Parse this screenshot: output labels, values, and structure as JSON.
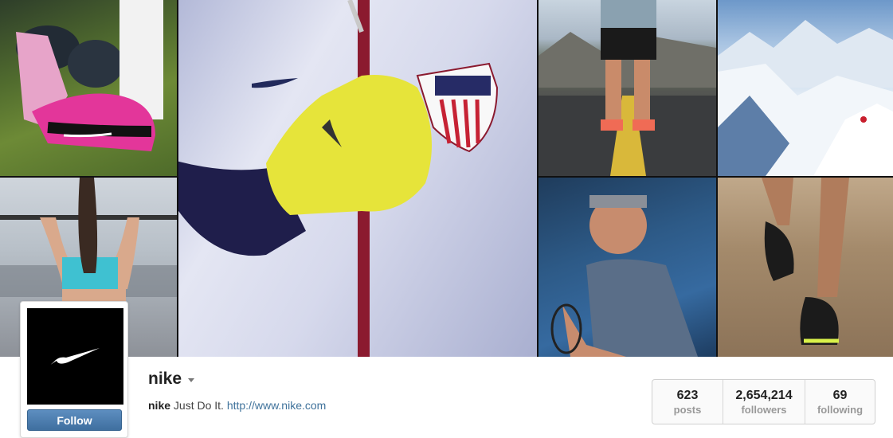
{
  "profile": {
    "username": "nike",
    "bio_name": "nike",
    "bio_text": "Just Do It.",
    "bio_link": "http://www.nike.com",
    "follow_label": "Follow"
  },
  "stats": [
    {
      "value": "623",
      "label": "posts"
    },
    {
      "value": "2,654,214",
      "label": "followers"
    },
    {
      "value": "69",
      "label": "following"
    }
  ],
  "colors": {
    "link": "#3f729b",
    "follow_button": "#4a7eb0"
  },
  "icons": {
    "avatar": "nike-swoosh-icon",
    "dropdown": "caret-down-icon"
  }
}
